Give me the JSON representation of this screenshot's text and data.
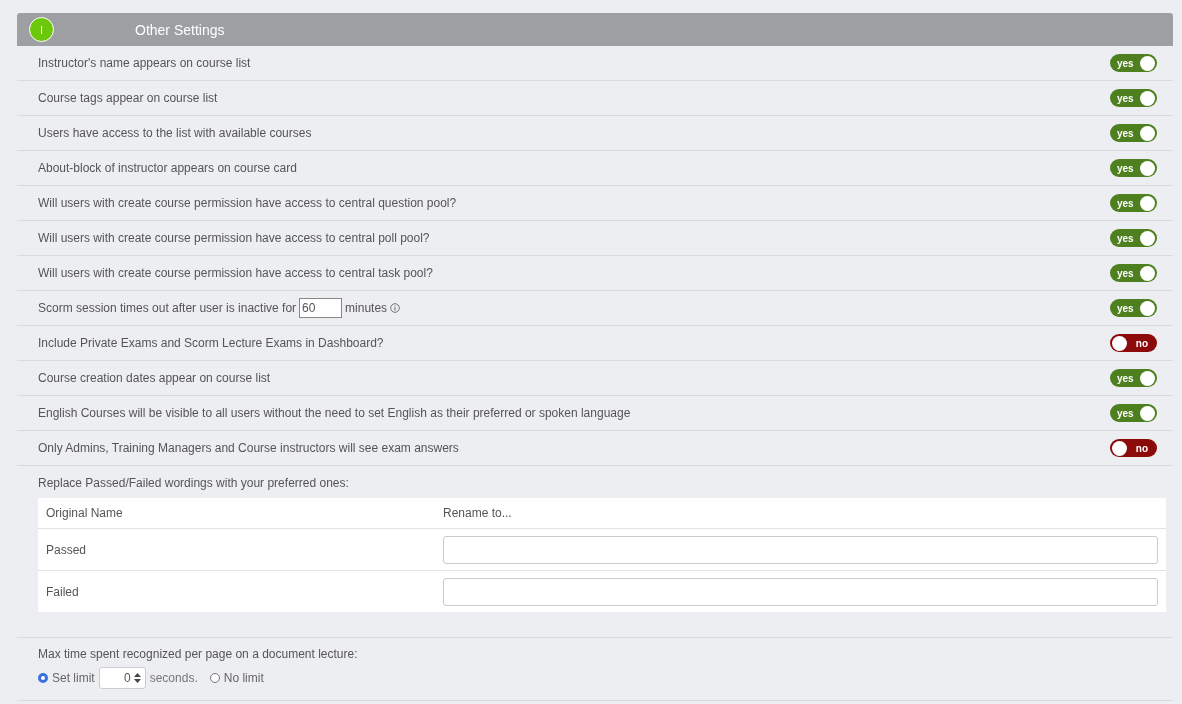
{
  "section": {
    "badge": "I",
    "title": "Other Settings"
  },
  "settings": [
    {
      "kind": "toggle",
      "label": "Instructor's name appears on course list",
      "on": true,
      "state_text": "yes"
    },
    {
      "kind": "toggle",
      "label": "Course tags appear on course list",
      "on": true,
      "state_text": "yes"
    },
    {
      "kind": "toggle",
      "label": "Users have access to the list with available courses",
      "on": true,
      "state_text": "yes"
    },
    {
      "kind": "toggle",
      "label": "About-block of instructor appears on course card",
      "on": true,
      "state_text": "yes"
    },
    {
      "kind": "toggle",
      "label": "Will users with create course permission have access to central question pool?",
      "on": true,
      "state_text": "yes"
    },
    {
      "kind": "toggle",
      "label": "Will users with create course permission have access to central poll pool?",
      "on": true,
      "state_text": "yes"
    },
    {
      "kind": "toggle",
      "label": "Will users with create course permission have access to central task pool?",
      "on": true,
      "state_text": "yes"
    },
    {
      "kind": "timeout",
      "label": "Scorm session times out after user is inactive for",
      "value": "60",
      "unit": "minutes",
      "on": true,
      "state_text": "yes"
    },
    {
      "kind": "toggle",
      "label": "Include Private Exams and Scorm Lecture Exams in Dashboard?",
      "on": false,
      "state_text": "no"
    },
    {
      "kind": "toggle",
      "label": "Course creation dates appear on course list",
      "on": true,
      "state_text": "yes"
    },
    {
      "kind": "toggle",
      "label": "English Courses will be visible to all users without the need to set English as their preferred or spoken language",
      "on": true,
      "state_text": "yes"
    },
    {
      "kind": "toggle",
      "label": "Only Admins, Training Managers and Course instructors will see exam answers",
      "on": false,
      "state_text": "no"
    }
  ],
  "rename": {
    "intro": "Replace Passed/Failed wordings with your preferred ones:",
    "columns": [
      "Original Name",
      "Rename to..."
    ],
    "rows": [
      {
        "name": "Passed"
      },
      {
        "name": "Failed"
      }
    ]
  },
  "page_time": {
    "label": "Max time spent recognized per page on a document lecture:",
    "options": [
      {
        "label": "Set limit",
        "selected": true,
        "value": "0",
        "unit": "seconds."
      },
      {
        "label": "No limit",
        "selected": false
      }
    ]
  }
}
